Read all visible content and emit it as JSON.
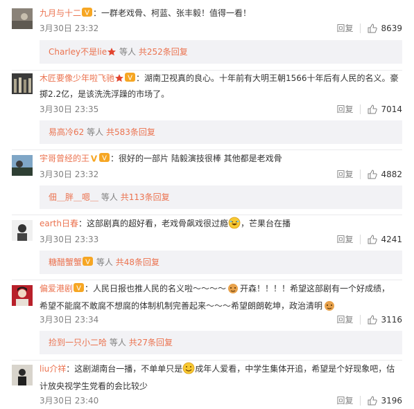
{
  "reply_label": "回复",
  "others_label": "等人",
  "comments": [
    {
      "username": "九月与十二",
      "text": "：一群老戏骨、柯蓝、张丰毅！值得一看！",
      "time": "3月30日 23:32",
      "likes": "8639",
      "sub": {
        "name": "Charley不是lie",
        "total": "共252条回复"
      }
    },
    {
      "username": "木匠要像少年啦飞驰",
      "text_a": "：湖南卫视真的良心。十年前有大明王朝1566十年后有人民的名义。豪",
      "text_b": "掷2.2亿，是该洗洗浮躁的市场了。",
      "time": "3月30日 23:35",
      "likes": "7014",
      "sub": {
        "name": "易高冷62",
        "total": "共583条回复"
      }
    },
    {
      "username": "宇哥曾经的王",
      "text": "：很好的一部片 陆毅演技很棒 其他都是老戏骨",
      "time": "3月30日 23:32",
      "likes": "4882",
      "sub": {
        "name": "佃＿胖＿嗯＿",
        "total": "共113条回复"
      }
    },
    {
      "username": "earth日春",
      "text_a": "：这部剧真的超好看，老戏骨飙戏很过瘾",
      "text_b": "，芒果台在播",
      "time": "3月30日 23:33",
      "likes": "4241",
      "sub": {
        "name": "糖醋蟹蟹",
        "total": "共48条回复"
      }
    },
    {
      "username": "偏爱港剧",
      "text_a": "：人民日报也推人民的名义啦～～～～",
      "text_a2": "开森！！！！希望这部剧有一个好成绩，",
      "text_b": "希望不能腐不敢腐不想腐的体制机制完善起来～～～希望朗朗乾坤，政治清明",
      "time": "3月30日 23:34",
      "likes": "3116",
      "sub": {
        "name": "捡到一只小二哈",
        "total": "共27条回复"
      }
    },
    {
      "username": "liu介祥",
      "text_a": "：这剧湖南台一播，不单单只是",
      "text_a2": "成年人爱看，中学生集体开追，希望是个好现象吧，估",
      "text_b": "计放央视学生党看的会比较少",
      "time": "3月30日 23:40",
      "likes": "3196"
    }
  ],
  "colors": {
    "accent": "#eb7350",
    "gray": "#808080",
    "subbg": "#f2f2f5"
  }
}
